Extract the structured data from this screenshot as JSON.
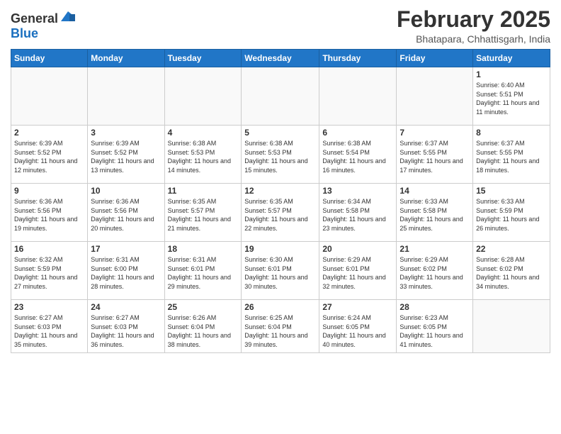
{
  "logo": {
    "general": "General",
    "blue": "Blue"
  },
  "title": "February 2025",
  "location": "Bhatapara, Chhattisgarh, India",
  "headers": [
    "Sunday",
    "Monday",
    "Tuesday",
    "Wednesday",
    "Thursday",
    "Friday",
    "Saturday"
  ],
  "weeks": [
    [
      {
        "day": "",
        "info": ""
      },
      {
        "day": "",
        "info": ""
      },
      {
        "day": "",
        "info": ""
      },
      {
        "day": "",
        "info": ""
      },
      {
        "day": "",
        "info": ""
      },
      {
        "day": "",
        "info": ""
      },
      {
        "day": "1",
        "info": "Sunrise: 6:40 AM\nSunset: 5:51 PM\nDaylight: 11 hours and 11 minutes."
      }
    ],
    [
      {
        "day": "2",
        "info": "Sunrise: 6:39 AM\nSunset: 5:52 PM\nDaylight: 11 hours and 12 minutes."
      },
      {
        "day": "3",
        "info": "Sunrise: 6:39 AM\nSunset: 5:52 PM\nDaylight: 11 hours and 13 minutes."
      },
      {
        "day": "4",
        "info": "Sunrise: 6:38 AM\nSunset: 5:53 PM\nDaylight: 11 hours and 14 minutes."
      },
      {
        "day": "5",
        "info": "Sunrise: 6:38 AM\nSunset: 5:53 PM\nDaylight: 11 hours and 15 minutes."
      },
      {
        "day": "6",
        "info": "Sunrise: 6:38 AM\nSunset: 5:54 PM\nDaylight: 11 hours and 16 minutes."
      },
      {
        "day": "7",
        "info": "Sunrise: 6:37 AM\nSunset: 5:55 PM\nDaylight: 11 hours and 17 minutes."
      },
      {
        "day": "8",
        "info": "Sunrise: 6:37 AM\nSunset: 5:55 PM\nDaylight: 11 hours and 18 minutes."
      }
    ],
    [
      {
        "day": "9",
        "info": "Sunrise: 6:36 AM\nSunset: 5:56 PM\nDaylight: 11 hours and 19 minutes."
      },
      {
        "day": "10",
        "info": "Sunrise: 6:36 AM\nSunset: 5:56 PM\nDaylight: 11 hours and 20 minutes."
      },
      {
        "day": "11",
        "info": "Sunrise: 6:35 AM\nSunset: 5:57 PM\nDaylight: 11 hours and 21 minutes."
      },
      {
        "day": "12",
        "info": "Sunrise: 6:35 AM\nSunset: 5:57 PM\nDaylight: 11 hours and 22 minutes."
      },
      {
        "day": "13",
        "info": "Sunrise: 6:34 AM\nSunset: 5:58 PM\nDaylight: 11 hours and 23 minutes."
      },
      {
        "day": "14",
        "info": "Sunrise: 6:33 AM\nSunset: 5:58 PM\nDaylight: 11 hours and 25 minutes."
      },
      {
        "day": "15",
        "info": "Sunrise: 6:33 AM\nSunset: 5:59 PM\nDaylight: 11 hours and 26 minutes."
      }
    ],
    [
      {
        "day": "16",
        "info": "Sunrise: 6:32 AM\nSunset: 5:59 PM\nDaylight: 11 hours and 27 minutes."
      },
      {
        "day": "17",
        "info": "Sunrise: 6:31 AM\nSunset: 6:00 PM\nDaylight: 11 hours and 28 minutes."
      },
      {
        "day": "18",
        "info": "Sunrise: 6:31 AM\nSunset: 6:01 PM\nDaylight: 11 hours and 29 minutes."
      },
      {
        "day": "19",
        "info": "Sunrise: 6:30 AM\nSunset: 6:01 PM\nDaylight: 11 hours and 30 minutes."
      },
      {
        "day": "20",
        "info": "Sunrise: 6:29 AM\nSunset: 6:01 PM\nDaylight: 11 hours and 32 minutes."
      },
      {
        "day": "21",
        "info": "Sunrise: 6:29 AM\nSunset: 6:02 PM\nDaylight: 11 hours and 33 minutes."
      },
      {
        "day": "22",
        "info": "Sunrise: 6:28 AM\nSunset: 6:02 PM\nDaylight: 11 hours and 34 minutes."
      }
    ],
    [
      {
        "day": "23",
        "info": "Sunrise: 6:27 AM\nSunset: 6:03 PM\nDaylight: 11 hours and 35 minutes."
      },
      {
        "day": "24",
        "info": "Sunrise: 6:27 AM\nSunset: 6:03 PM\nDaylight: 11 hours and 36 minutes."
      },
      {
        "day": "25",
        "info": "Sunrise: 6:26 AM\nSunset: 6:04 PM\nDaylight: 11 hours and 38 minutes."
      },
      {
        "day": "26",
        "info": "Sunrise: 6:25 AM\nSunset: 6:04 PM\nDaylight: 11 hours and 39 minutes."
      },
      {
        "day": "27",
        "info": "Sunrise: 6:24 AM\nSunset: 6:05 PM\nDaylight: 11 hours and 40 minutes."
      },
      {
        "day": "28",
        "info": "Sunrise: 6:23 AM\nSunset: 6:05 PM\nDaylight: 11 hours and 41 minutes."
      },
      {
        "day": "",
        "info": ""
      }
    ]
  ]
}
